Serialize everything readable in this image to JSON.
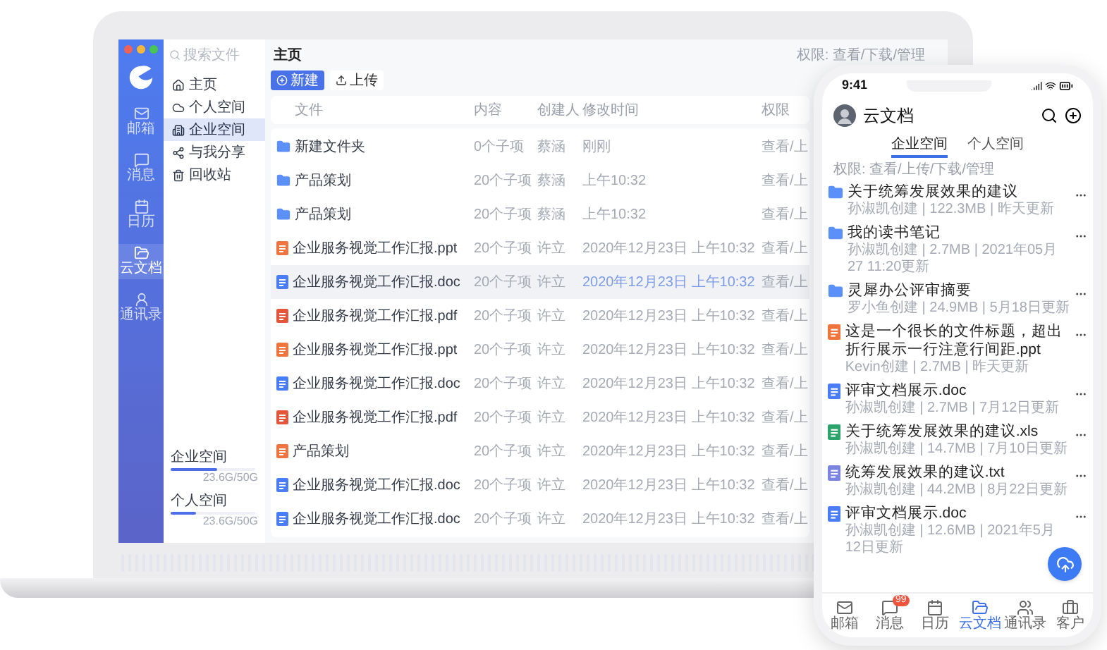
{
  "laptop": {
    "rail": [
      {
        "label": "邮箱",
        "selected": false
      },
      {
        "label": "消息",
        "selected": false
      },
      {
        "label": "日历",
        "selected": false
      },
      {
        "label": "云文档",
        "selected": true
      },
      {
        "label": "通讯录",
        "selected": false
      }
    ],
    "search": {
      "placeholder": "搜索文件"
    },
    "nav": [
      {
        "label": "主页",
        "selected": false
      },
      {
        "label": "个人空间",
        "selected": false
      },
      {
        "label": "企业空间",
        "selected": true
      },
      {
        "label": "与我分享",
        "selected": false
      },
      {
        "label": "回收站",
        "selected": false
      }
    ],
    "storage": [
      {
        "label": "企业空间",
        "value": "23.6G/50G",
        "level": 0.55
      },
      {
        "label": "个人空间",
        "value": "23.6G/50G",
        "level": 0.3
      }
    ],
    "title": "主页",
    "permission": "权限: 查看/下载/管理",
    "buttons": [
      {
        "label": "新建",
        "kind": "primary"
      },
      {
        "label": "上传",
        "kind": "secondary"
      }
    ],
    "table": {
      "columns": [
        "文件",
        "内容",
        "创建人",
        "修改时间",
        "权限"
      ],
      "rows": [
        {
          "kind": "folder",
          "selected": false,
          "cells": [
            "新建文件夹",
            "0个子项",
            "蔡涵",
            "刚刚",
            "查看/上"
          ]
        },
        {
          "kind": "folder",
          "selected": false,
          "cells": [
            "产品策划",
            "20个子项",
            "蔡涵",
            "上午10:32",
            "查看/上"
          ]
        },
        {
          "kind": "folder",
          "selected": false,
          "cells": [
            "产品策划",
            "20个子项",
            "蔡涵",
            "上午10:32",
            "查看/上"
          ]
        },
        {
          "kind": "ppt",
          "selected": false,
          "cells": [
            "企业服务视觉工作汇报.ppt",
            "20个子项",
            "许立",
            "2020年12月23日 上午10:32",
            "查看/上"
          ]
        },
        {
          "kind": "doc",
          "selected": true,
          "cells": [
            "企业服务视觉工作汇报.doc",
            "20个子项",
            "许立",
            "2020年12月23日 上午10:32",
            "查看/上"
          ]
        },
        {
          "kind": "pdf",
          "selected": false,
          "cells": [
            "企业服务视觉工作汇报.pdf",
            "20个子项",
            "许立",
            "2020年12月23日 上午10:32",
            "查看/上"
          ]
        },
        {
          "kind": "ppt",
          "selected": false,
          "cells": [
            "企业服务视觉工作汇报.ppt",
            "20个子项",
            "许立",
            "2020年12月23日 上午10:32",
            "查看/上"
          ]
        },
        {
          "kind": "doc",
          "selected": false,
          "cells": [
            "企业服务视觉工作汇报.doc",
            "20个子项",
            "许立",
            "2020年12月23日 上午10:32",
            "查看/上"
          ]
        },
        {
          "kind": "pdf",
          "selected": false,
          "cells": [
            "企业服务视觉工作汇报.pdf",
            "20个子项",
            "许立",
            "2020年12月23日 上午10:32",
            "查看/上"
          ]
        },
        {
          "kind": "ppt",
          "selected": false,
          "cells": [
            "产品策划",
            "20个子项",
            "许立",
            "2020年12月23日 上午10:32",
            "查看/上"
          ]
        },
        {
          "kind": "doc",
          "selected": false,
          "cells": [
            "企业服务视觉工作汇报.doc",
            "20个子项",
            "许立",
            "2020年12月23日 上午10:32",
            "查看/上"
          ]
        },
        {
          "kind": "doc",
          "selected": false,
          "cells": [
            "企业服务视觉工作汇报.doc",
            "20个子项",
            "许立",
            "2020年12月23日 上午10:32",
            "查看/上"
          ]
        }
      ]
    }
  },
  "phone": {
    "time": "9:41",
    "title": "云文档",
    "tabs": [
      {
        "label": "企业空间",
        "selected": true
      },
      {
        "label": "个人空间",
        "selected": false
      }
    ],
    "permission": "权限: 查看/上传/下载/管理",
    "files": [
      {
        "kind": "folder",
        "name": "关于统筹发展效果的建议",
        "meta": "孙淑凯创建 | 122.3MB | 昨天更新"
      },
      {
        "kind": "folder",
        "name": "我的读书笔记",
        "meta": "孙淑凯创建 | 2.7MB | 2021年05月27 11:20更新"
      },
      {
        "kind": "folder",
        "name": "灵犀办公评审摘要",
        "meta": "罗小鱼创建 | 24.9MB | 5月18日更新"
      },
      {
        "kind": "ppt",
        "name": "这是一个很长的文件标题，超出折行展示一行注意行间距.ppt",
        "meta": "Kevin创建 | 2.7MB | 昨天更新"
      },
      {
        "kind": "doc",
        "name": "评审文档展示.doc",
        "meta": "孙淑凯创建 | 2.7MB | 7月12日更新"
      },
      {
        "kind": "xls",
        "name": "关于统筹发展效果的建议.xls",
        "meta": "孙淑凯创建 | 14.7MB | 7月10日更新"
      },
      {
        "kind": "txt",
        "name": "统筹发展效果的建议.txt",
        "meta": "孙淑凯创建 | 44.2MB | 8月22日更新"
      },
      {
        "kind": "doc",
        "name": "评审文档展示.doc",
        "meta": "孙淑凯创建 | 12.6MB | 2021年5月12日更新"
      }
    ],
    "tabbar": [
      {
        "label": "邮箱",
        "selected": false
      },
      {
        "label": "消息",
        "selected": false,
        "badge": "99"
      },
      {
        "label": "日历",
        "selected": false
      },
      {
        "label": "云文档",
        "selected": true
      },
      {
        "label": "通讯录",
        "selected": false
      },
      {
        "label": "客户",
        "selected": false
      }
    ]
  }
}
